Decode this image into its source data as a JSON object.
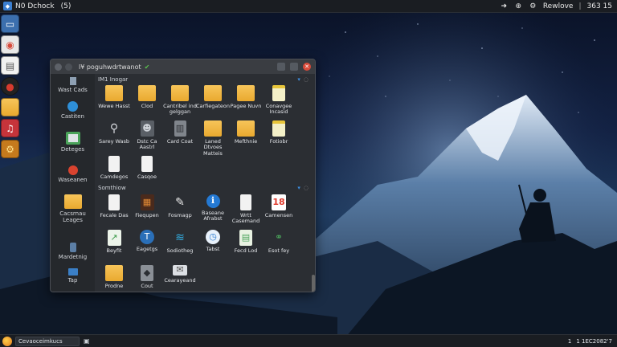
{
  "top_panel": {
    "app_name": "N0 Dchock",
    "indicator": "(5)",
    "right_label": "Rewlove",
    "clock": "363 15"
  },
  "dock": {
    "items": [
      {
        "icon": "window-icon",
        "glyph": "▭"
      },
      {
        "icon": "chrome-icon",
        "glyph": "◉"
      },
      {
        "icon": "document-icon",
        "glyph": "▤"
      },
      {
        "icon": "disc-icon",
        "glyph": "●"
      },
      {
        "icon": "folder-icon",
        "glyph": "▬"
      },
      {
        "icon": "music-icon",
        "glyph": "♫"
      },
      {
        "icon": "gear-icon",
        "glyph": "⚙"
      }
    ]
  },
  "window": {
    "title": "l¥ poguhwdrtwanot",
    "sidebar": [
      {
        "label": "Wast Cads",
        "icon": "bookmark-icon",
        "glyph": "▮",
        "color": "#8ea0b3"
      },
      {
        "label": "Castiten",
        "icon": "globe-icon",
        "glyph": "●",
        "color": "#2e8fd8"
      },
      {
        "label": "Deteges",
        "icon": "app-icon",
        "glyph": "◎",
        "color": "#4aa35a"
      },
      {
        "label": "Waseanen",
        "icon": "red-dot-icon",
        "glyph": "●",
        "color": "#d9432f"
      },
      {
        "label": "Cacsrnau\nLeages",
        "icon": "folder-icon",
        "glyph": "",
        "color": "#f2b845"
      },
      {
        "label": "Mardetnig",
        "icon": "device-icon",
        "glyph": "▯",
        "color": "#5c7fa6"
      },
      {
        "label": "Tap",
        "icon": "monitor-icon",
        "glyph": "▭",
        "color": "#3a7fc6"
      }
    ],
    "section1": {
      "title": "IM1 Inogar",
      "items": [
        {
          "label": "Wewe Hasst",
          "icon": "folder-icon",
          "type": "folder"
        },
        {
          "label": "Clod",
          "icon": "folder-icon",
          "type": "folder"
        },
        {
          "label": "Cantribel ind\ngelggan",
          "icon": "folder-icon",
          "type": "folder"
        },
        {
          "label": "Carfiegateon",
          "icon": "folder-icon",
          "type": "folder"
        },
        {
          "label": "Pagee Nuvn",
          "icon": "folder-icon",
          "type": "folder"
        },
        {
          "label": "Conavgee\nIncasid",
          "icon": "yellow-doc-icon",
          "type": "note"
        },
        {
          "label": "Sarey Wasb",
          "icon": "wrench-icon",
          "type": "tool"
        },
        {
          "label": "Dstc Ca\nAastrl",
          "icon": "user-icon",
          "type": "user"
        },
        {
          "label": "Card Coat",
          "icon": "trash-icon",
          "type": "gray"
        },
        {
          "label": "Laned Dtvoes\nMatteis",
          "icon": "folder-icon",
          "type": "folder"
        },
        {
          "label": "Mefthnie",
          "icon": "folder-icon",
          "type": "folder"
        },
        {
          "label": "Fotiobr",
          "icon": "notepad-icon",
          "type": "note"
        },
        {
          "label": "Camdegos",
          "icon": "document-icon",
          "type": "doc"
        },
        {
          "label": "Casqoe",
          "icon": "document-icon",
          "type": "doc"
        }
      ]
    },
    "section2": {
      "title": "Somthiow",
      "items": [
        {
          "label": "Fecale Das",
          "icon": "document-icon",
          "type": "doc"
        },
        {
          "label": "Fiequpen",
          "icon": "film-icon",
          "type": "film"
        },
        {
          "label": "Fosmagp",
          "icon": "pen-icon",
          "type": "pen"
        },
        {
          "label": "Baseane\nAfrabst",
          "icon": "info-icon",
          "type": "info"
        },
        {
          "label": "Wrtt\nCasemand",
          "icon": "document-icon",
          "type": "doc"
        },
        {
          "label": "Camensen",
          "icon": "calendar-icon",
          "type": "calendar"
        },
        {
          "label": "Beyfit",
          "icon": "chart-icon",
          "type": "chart"
        },
        {
          "label": "Eagetgs",
          "icon": "t-icon",
          "type": "blue"
        },
        {
          "label": "Sodiotheg",
          "icon": "wifi-icon",
          "type": "wifi"
        },
        {
          "label": "Tabst",
          "icon": "clock-icon",
          "type": "clock"
        },
        {
          "label": "Fecd Lod",
          "icon": "book-icon",
          "type": "book"
        },
        {
          "label": "Esot fey",
          "icon": "molecule-icon",
          "type": "molecule"
        },
        {
          "label": "Prodne",
          "icon": "folder-icon",
          "type": "folder"
        },
        {
          "label": "Cout",
          "icon": "box-icon",
          "type": "box"
        },
        {
          "label": "Cearayeand",
          "icon": "mail-icon",
          "type": "mail"
        }
      ]
    }
  },
  "taskbar": {
    "task_label": "Cevaoceimkucs",
    "tray": "1",
    "clock": "1 1EC2082'7"
  }
}
